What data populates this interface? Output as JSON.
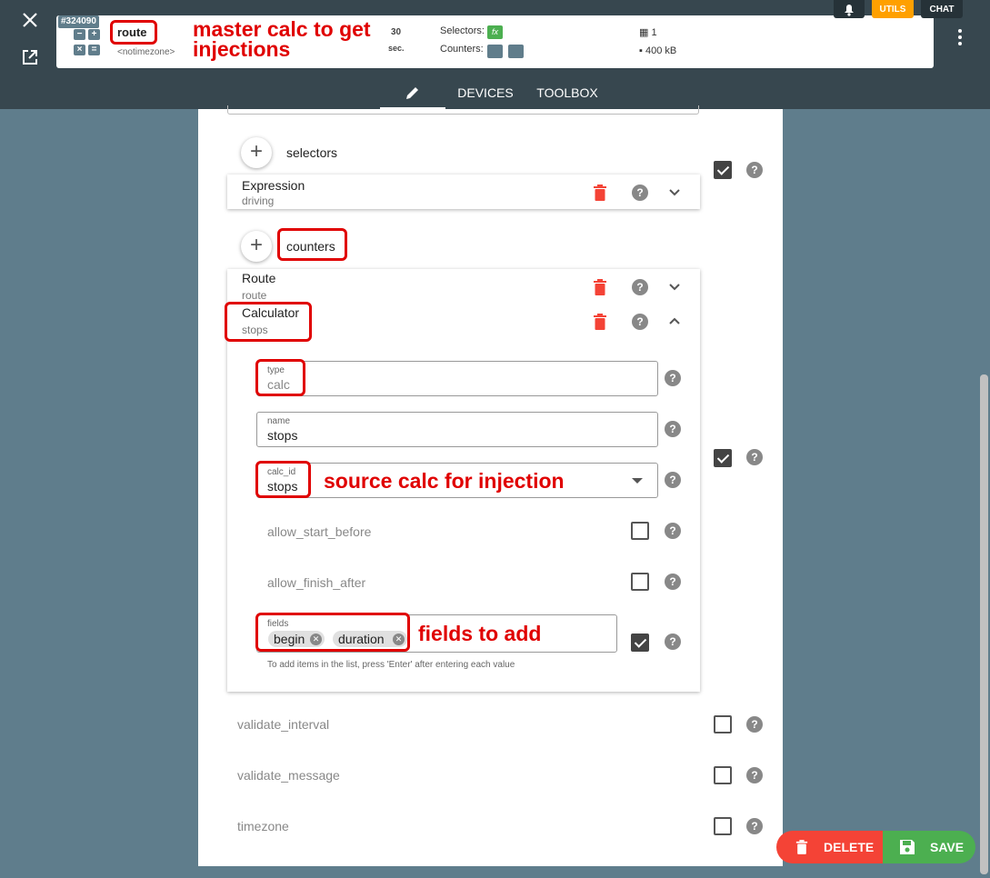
{
  "header": {
    "id_badge": "#324090",
    "route_name": "route",
    "timezone": "<notimezone>",
    "period_value": "30",
    "period_unit": "sec.",
    "selectors_label": "Selectors:",
    "counters_label": "Counters:",
    "stat_units": "1",
    "stat_size": "400 kB",
    "utils_label": "UTILS",
    "chat_label": "CHAT"
  },
  "tabs": [
    {
      "label": "DEVICES"
    },
    {
      "label": "TOOLBOX"
    }
  ],
  "annotations": {
    "title": "master calc to get injections",
    "calc_id": "source calc for injection",
    "fields": "fields to add"
  },
  "selectors": {
    "label": "selectors",
    "items": [
      {
        "title": "Expression",
        "sub": "driving"
      }
    ]
  },
  "counters": {
    "label": "counters",
    "items": [
      {
        "title": "Route",
        "sub": "route"
      },
      {
        "title": "Calculator",
        "sub": "stops"
      }
    ]
  },
  "calculator_form": {
    "type": {
      "label": "type",
      "value": "calc"
    },
    "name": {
      "label": "name",
      "value": "stops"
    },
    "calc_id": {
      "label": "calc_id",
      "value": "stops"
    },
    "allow_start_before": "allow_start_before",
    "allow_finish_after": "allow_finish_after",
    "fields": {
      "label": "fields",
      "chips": [
        "begin",
        "duration"
      ],
      "hint": "To add items in the list, press 'Enter' after entering each value"
    }
  },
  "options": {
    "validate_interval": "validate_interval",
    "validate_message": "validate_message",
    "timezone": "timezone"
  },
  "actions": {
    "delete_label": "DELETE",
    "save_label": "SAVE"
  },
  "colors": {
    "header_bg": "#37474f",
    "page_bg": "#5f7d8c",
    "annotation_red": "#e00000",
    "delete_red": "#f44336",
    "save_green": "#4caf50",
    "utils_orange": "#ffa000"
  }
}
